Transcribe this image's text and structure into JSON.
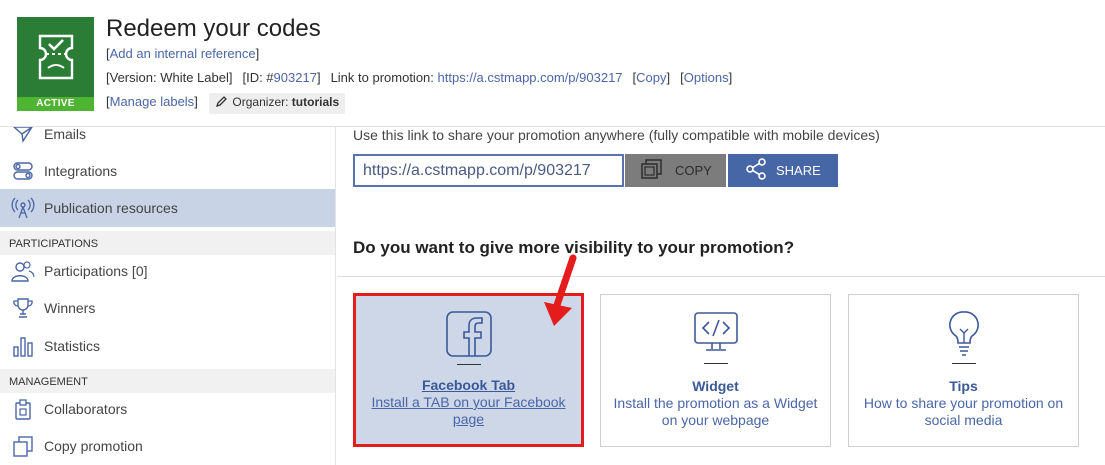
{
  "header": {
    "status_badge": "ACTIVE",
    "title": "Redeem your codes",
    "add_reference": "Add an internal reference",
    "version_label": "[Version: White Label]",
    "id_prefix": "[ID: #",
    "id_value": "903217",
    "id_suffix": "]",
    "link_label": "Link to promotion:",
    "link_url": "https://a.cstmapp.com/p/903217",
    "copy_link": "Copy",
    "options_link": "Options",
    "manage_labels": "Manage labels",
    "organizer_label": "Organizer:",
    "organizer_value": "tutorials"
  },
  "sidebar": {
    "items": [
      {
        "label": "Emails",
        "icon": "paper-plane-icon"
      },
      {
        "label": "Integrations",
        "icon": "toggles-icon"
      },
      {
        "label": "Publication resources",
        "icon": "antenna-icon"
      }
    ],
    "section_participations": "PARTICIPATIONS",
    "participations_items": [
      {
        "label": "Participations [0]",
        "icon": "users-icon"
      },
      {
        "label": "Winners",
        "icon": "trophy-icon"
      },
      {
        "label": "Statistics",
        "icon": "bar-chart-icon"
      }
    ],
    "section_management": "MANAGEMENT",
    "management_items": [
      {
        "label": "Collaborators",
        "icon": "badge-icon"
      },
      {
        "label": "Copy promotion",
        "icon": "copy-icon"
      }
    ]
  },
  "main": {
    "hint": "Use this link to share your promotion anywhere (fully compatible with mobile devices)",
    "url_value": "https://a.cstmapp.com/p/903217",
    "copy_button": "COPY",
    "share_button": "SHARE",
    "visibility_heading": "Do you want to give more visibility to your promotion?",
    "cards": [
      {
        "title": "Facebook Tab",
        "description": "Install a TAB on your Facebook page",
        "icon": "facebook-icon"
      },
      {
        "title": "Widget",
        "description": "Install the promotion as a Widget on your webpage",
        "icon": "code-monitor-icon"
      },
      {
        "title": "Tips",
        "description": "How to share your promotion on social media",
        "icon": "lightbulb-icon"
      }
    ]
  },
  "colors": {
    "brand_green": "#2b7d36",
    "badge_green": "#4fb431",
    "link_blue": "#4a66a8",
    "share_blue": "#4766a6",
    "active_bg": "#c8d3e6",
    "highlight_red": "#e51c1c"
  }
}
